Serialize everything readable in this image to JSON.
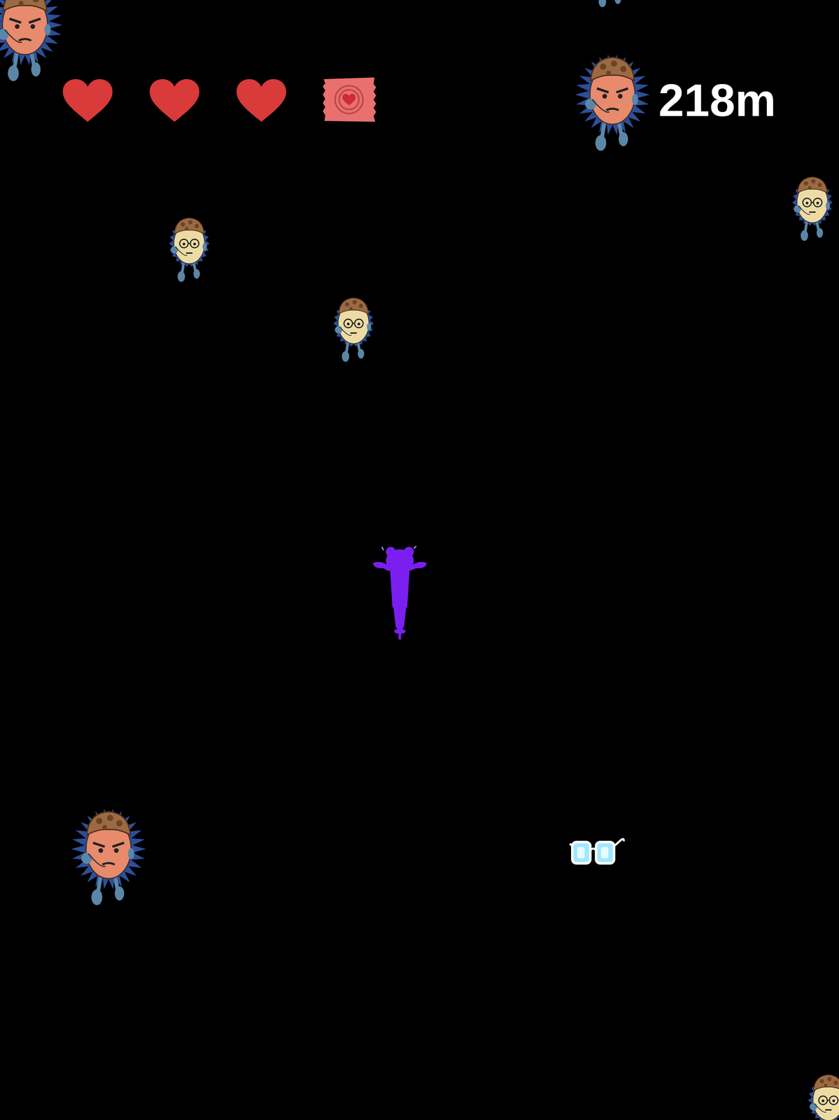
{
  "hud": {
    "hearts": [
      {
        "filled": true
      },
      {
        "filled": true
      },
      {
        "filled": true
      }
    ],
    "distance": "218m"
  },
  "enemies": [
    {
      "kind": "angry"
    },
    {
      "kind": "calm"
    },
    {
      "kind": "calm"
    },
    {
      "kind": "calm"
    },
    {
      "kind": "calm"
    },
    {
      "kind": "angry"
    },
    {
      "kind": "calm"
    }
  ],
  "pickups": [
    {
      "kind": "glasses"
    }
  ]
}
